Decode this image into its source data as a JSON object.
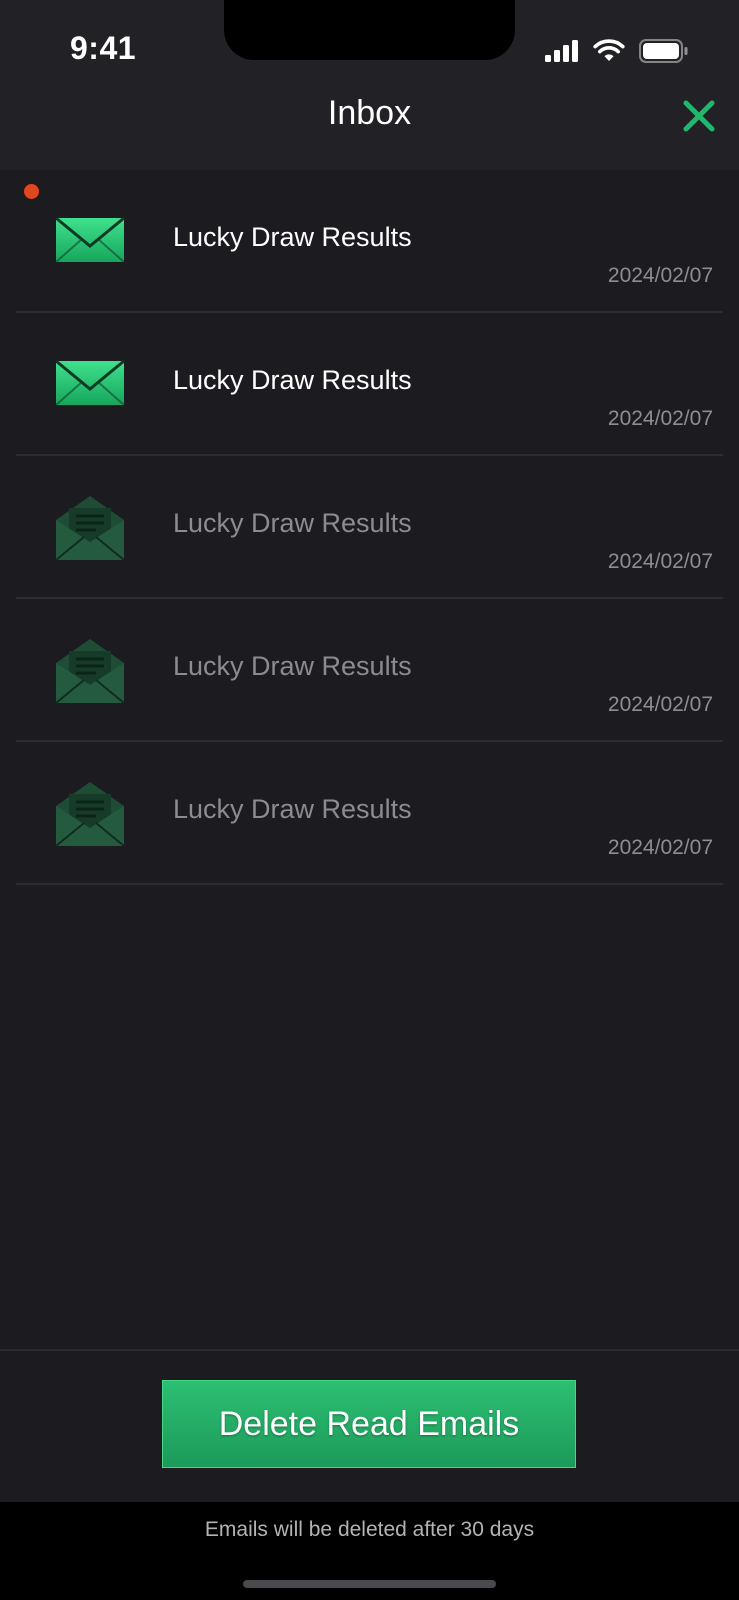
{
  "status_bar": {
    "time": "9:41",
    "icons": [
      "signal-icon",
      "wifi-icon",
      "battery-icon"
    ]
  },
  "header": {
    "title": "Inbox",
    "close_icon": "close-icon",
    "accent_color": "#22b86b"
  },
  "mails": [
    {
      "subject": "Lucky Draw Results",
      "date": "2024/02/07",
      "status": "unread",
      "new": true
    },
    {
      "subject": "Lucky Draw Results",
      "date": "2024/02/07",
      "status": "unread",
      "new": false
    },
    {
      "subject": "Lucky Draw Results",
      "date": "2024/02/07",
      "status": "read",
      "new": false
    },
    {
      "subject": "Lucky Draw Results",
      "date": "2024/02/07",
      "status": "read",
      "new": false
    },
    {
      "subject": "Lucky Draw Results",
      "date": "2024/02/07",
      "status": "read",
      "new": false
    }
  ],
  "actions": {
    "delete_read_label": "Delete Read Emails"
  },
  "footer": {
    "note": "Emails will be deleted after 30 days"
  },
  "colors": {
    "background": "#1c1c20",
    "unread_dot": "#e2461c",
    "button_green": "#22b86b"
  }
}
